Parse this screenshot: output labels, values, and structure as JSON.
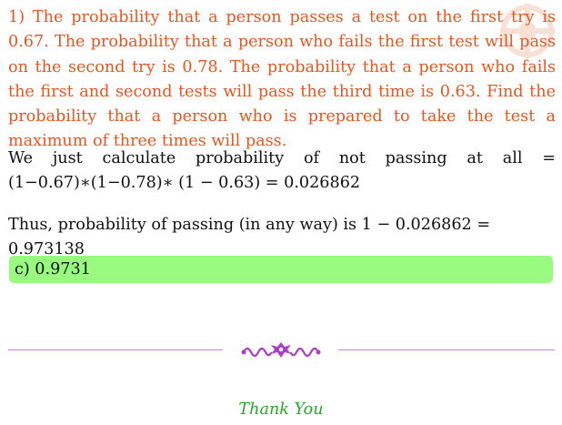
{
  "question": {
    "text": "1) The probability that a person passes a test on the first try is 0.67. The probability that a person who fails the first test will pass on the second try is 0.78. The probability that a person who fails the first and second tests will pass the third time is 0.63. Find the probability that a person who is prepared to take the test a maximum of three times will pass."
  },
  "solution": {
    "paragraph1": "We just calculate probability of not passing at all = (1−0.67)∗(1−0.78)∗ (1 − 0.63) = 0.026862",
    "paragraph2": "Thus, probability of passing (in any way) is 1 − 0.026862 = 0.973138"
  },
  "answer": {
    "text": "c) 0.9731"
  },
  "footer": {
    "thanks": "Thank You"
  },
  "colors": {
    "question": "#e8561e",
    "answer_bg": "#98fb80",
    "divider": "#c586d9",
    "ornament": "#a93fc9",
    "thanks": "#27a827"
  },
  "icons": {
    "ornament": "floral-divider-ornament",
    "watermark": "logo-watermark"
  }
}
